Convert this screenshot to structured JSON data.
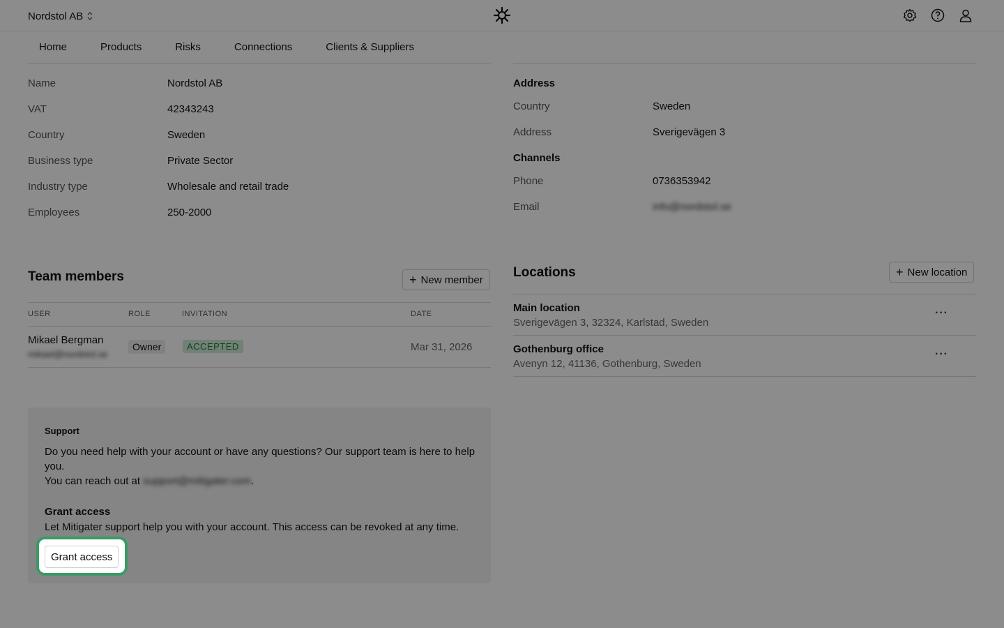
{
  "header": {
    "org_name": "Nordstol AB",
    "icons": [
      "settings-icon",
      "help-icon",
      "user-icon"
    ]
  },
  "nav": {
    "items": [
      "Home",
      "Products",
      "Risks",
      "Connections",
      "Clients & Suppliers"
    ]
  },
  "company": {
    "fields": [
      {
        "label": "Name",
        "value": "Nordstol AB"
      },
      {
        "label": "VAT",
        "value": "42343243"
      },
      {
        "label": "Country",
        "value": "Sweden"
      },
      {
        "label": "Business type",
        "value": "Private Sector"
      },
      {
        "label": "Industry type",
        "value": "Wholesale and retail trade"
      },
      {
        "label": "Employees",
        "value": "250-2000"
      }
    ]
  },
  "address": {
    "heading": "Address",
    "fields": [
      {
        "label": "Country",
        "value": "Sweden"
      },
      {
        "label": "Address",
        "value": "Sverigevägen 3"
      }
    ],
    "channels_heading": "Channels",
    "channels": [
      {
        "label": "Phone",
        "value": "0736353942"
      },
      {
        "label": "Email",
        "value": "info@nordstol.se"
      }
    ]
  },
  "team": {
    "title": "Team members",
    "new_button": "New member",
    "columns": [
      "USER",
      "ROLE",
      "INVITATION",
      "DATE"
    ],
    "rows": [
      {
        "name": "Mikael Bergman",
        "email": "mikael@nordstol.se",
        "role": "Owner",
        "invitation": "ACCEPTED",
        "date": "Mar 31, 2026"
      }
    ]
  },
  "locations": {
    "title": "Locations",
    "new_button": "New location",
    "items": [
      {
        "name": "Main location",
        "address": "Sverigevägen 3, 32324, Karlstad, Sweden"
      },
      {
        "name": "Gothenburg office",
        "address": "Avenyn 12, 41136, Gothenburg, Sweden"
      }
    ]
  },
  "support": {
    "title": "Support",
    "text1": "Do you need help with your account or have any questions? Our support team is here to help you.",
    "text2_prefix": "You can reach out at",
    "support_email": "support@mitigater.com",
    "text2_suffix": ".",
    "grant_title": "Grant access",
    "grant_text": "Let Mitigater support help you with your account. This access can be revoked at any time.",
    "grant_button": "Grant access"
  },
  "colors": {
    "highlight": "#3a9a66",
    "badge_bg": "#cfe9d6",
    "badge_fg": "#1f7a3b"
  }
}
